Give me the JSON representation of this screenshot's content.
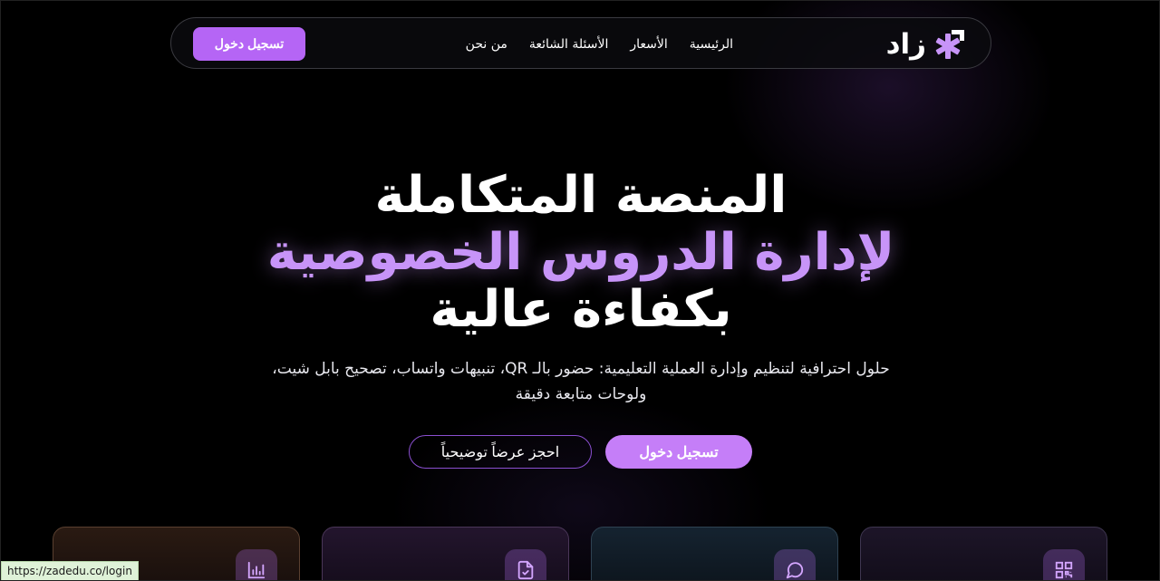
{
  "nav": {
    "cta_label": "تسجيل دخول",
    "links": [
      "الرئيسية",
      "الأسعار",
      "الأسئلة الشائعة",
      "من نحن"
    ],
    "logo_text": "زاد"
  },
  "hero": {
    "title_line1": "المنصة المتكاملة",
    "title_line2": "لإدارة الدروس الخصوصية",
    "title_line3": "بكفاءة عالية",
    "subtitle_line1": "حلول احترافية لتنظيم وإدارة العملية التعليمية: حضور بالـ QR، تنبيهات واتساب، تصحيح بابل شيت،",
    "subtitle_line2": "ولوحات متابعة دقيقة",
    "primary_button": "تسجيل دخول",
    "secondary_button": "احجز عرضاً توضيحياً"
  },
  "cards": [
    {
      "icon": "bar-chart-icon"
    },
    {
      "icon": "clipboard-check-icon"
    },
    {
      "icon": "chat-bubble-icon"
    },
    {
      "icon": "qr-code-icon"
    }
  ],
  "status_bar": {
    "url": "https://zadedu.co/login"
  },
  "colors": {
    "accent": "#b565f5",
    "accent_light": "#c794f8",
    "background": "#000000"
  }
}
